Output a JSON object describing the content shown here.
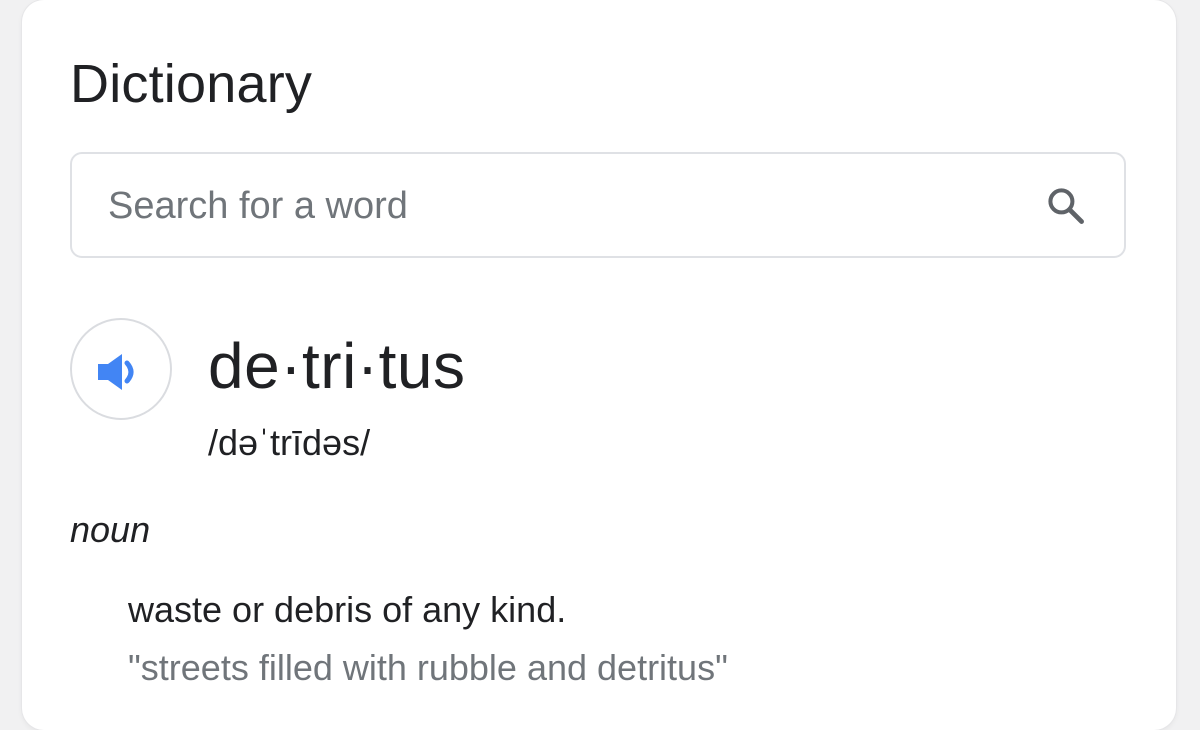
{
  "card": {
    "title": "Dictionary"
  },
  "search": {
    "placeholder": "Search for a word",
    "value": ""
  },
  "entry": {
    "headword": "de·tri·tus",
    "pronunciation": "/dəˈtrīdəs/",
    "part_of_speech": "noun",
    "definition": "waste or debris of any kind.",
    "example": "\"streets filled with rubble and detritus\""
  },
  "icons": {
    "search": "search-icon",
    "speaker": "speaker-icon"
  },
  "colors": {
    "accent": "#4285f4",
    "text_primary": "#202124",
    "text_secondary": "#70757a",
    "border": "#dfe1e5"
  }
}
